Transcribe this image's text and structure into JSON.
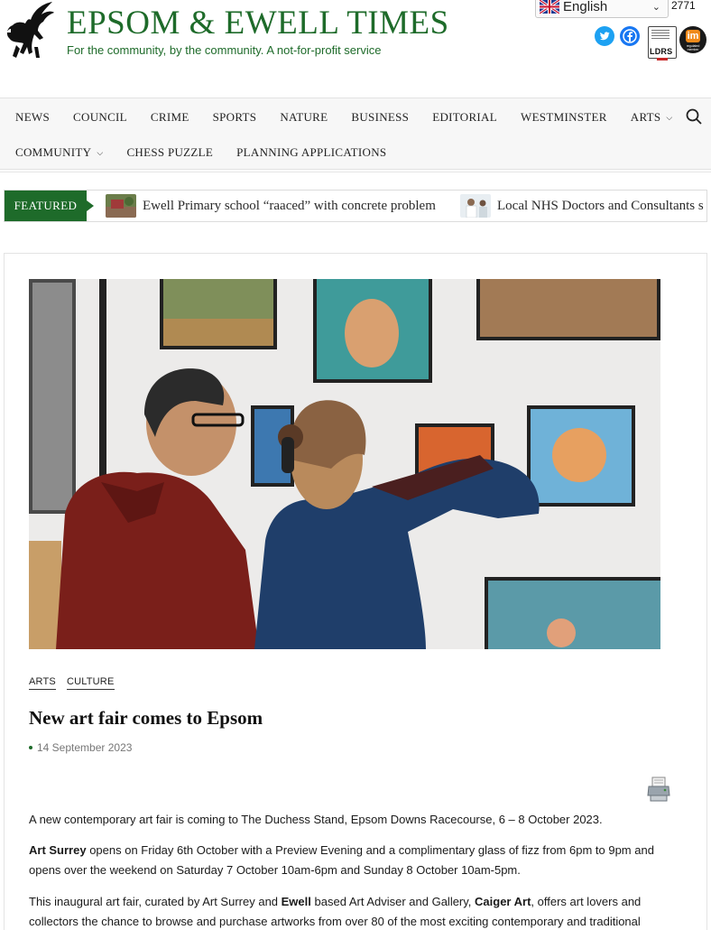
{
  "header": {
    "site_title": "EPSOM & EWELL TIMES",
    "tagline": "For the community, by the community. A not-for-profit service",
    "language": "English",
    "counter_text": "2771",
    "ldrs_label": "LDRS",
    "impress_label": "im",
    "impress_sub": "regulated member"
  },
  "nav": {
    "items_row1": [
      "NEWS",
      "COUNCIL",
      "CRIME",
      "SPORTS",
      "NATURE",
      "BUSINESS",
      "EDITORIAL",
      "WESTMINSTER",
      "ARTS"
    ],
    "items_row2": [
      "COMMUNITY",
      "CHESS PUZZLE",
      "PLANNING APPLICATIONS"
    ]
  },
  "ticker": {
    "label": "FEATURED",
    "items": [
      "Ewell Primary school “raaced” with concrete problem",
      "Local NHS Doctors and Consultants s"
    ]
  },
  "article": {
    "categories": [
      "ARTS",
      "CULTURE"
    ],
    "title": "New art fair comes to Epsom",
    "date": "14 September 2023",
    "p1": "A new contemporary art fair is coming to The Duchess Stand, Epsom Downs Racecourse, 6 – 8 October 2023.",
    "p2_bold": "Art Surrey",
    "p2_rest": " opens on Friday 6th October with a Preview Evening and a complimentary glass of fizz from 6pm to 9pm and opens over the weekend on Saturday 7 October 10am-6pm and Sunday 8 October 10am-5pm.",
    "p3_a": "This inaugural art fair, curated by Art Surrey and ",
    "p3_b": "Ewell",
    "p3_c": " based Art Adviser and Gallery, ",
    "p3_d": "Caiger Art",
    "p3_e": ", offers art lovers and collectors the chance to browse and purchase artworks from over 80 of the most exciting contemporary and traditional"
  },
  "colors": {
    "brand_green": "#1e6b2a",
    "twitter": "#1da1f2",
    "facebook": "#1877f2"
  }
}
